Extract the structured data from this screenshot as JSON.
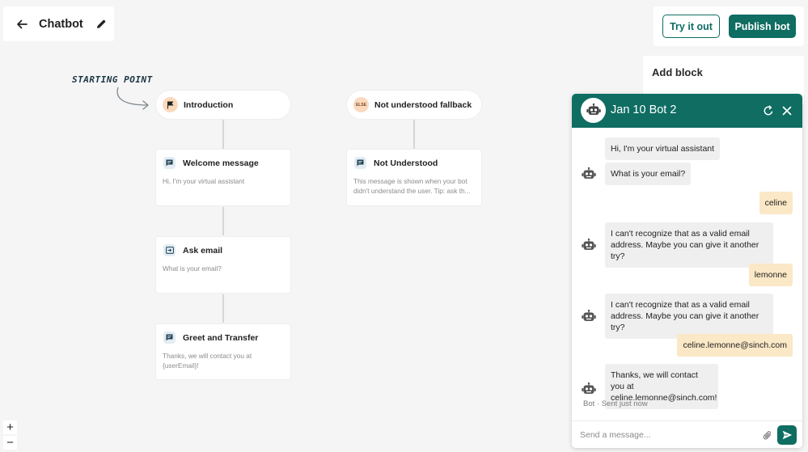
{
  "header": {
    "title": "Chatbot"
  },
  "actions": {
    "try_label": "Try it out",
    "publish_label": "Publish bot"
  },
  "sidebar": {
    "add_block_label": "Add block"
  },
  "canvas": {
    "starting_label": "STARTING POINT",
    "intro_label": "Introduction",
    "fallback_label": "Not understood fallback",
    "fallback_badge": "ELSE",
    "cards": [
      {
        "title": "Welcome message",
        "desc": "Hi, I'm your virtual assistant"
      },
      {
        "title": "Ask email",
        "desc": "What is your email?"
      },
      {
        "title": "Greet and Transfer",
        "desc": "Thanks, we will contact you at {userEmail}!"
      },
      {
        "title": "Not Understood",
        "desc": "This message is shown when your bot didn't understand the user. Tip: ask th..."
      }
    ],
    "zoom_in": "+",
    "zoom_out": "−"
  },
  "chat": {
    "bot_name": "Jan 10 Bot 2",
    "messages": [
      {
        "from": "bot",
        "text": "Hi, I'm your virtual assistant"
      },
      {
        "from": "bot",
        "text": "What is your email?"
      },
      {
        "from": "user",
        "text": "celine"
      },
      {
        "from": "bot",
        "text": "I can't recognize that as a valid email address. Maybe you can give it another try?"
      },
      {
        "from": "user",
        "text": "lemonne"
      },
      {
        "from": "bot",
        "text": "I can't recognize that as a valid email address. Maybe you can give it another try?"
      },
      {
        "from": "user",
        "text": "celine.lemonne@sinch.com"
      },
      {
        "from": "bot",
        "text": "Thanks, we will contact you at celine.lemonne@sinch.com!"
      }
    ],
    "status": "Bot · Sent just now",
    "input_placeholder": "Send a message..."
  },
  "colors": {
    "brand": "#0f6d62",
    "user_bubble": "#fbe8c6",
    "bot_bubble": "#efefef",
    "intro_badge": "#fbd9bd"
  },
  "icons": [
    "back-arrow-icon",
    "pencil-icon",
    "flag-icon",
    "message-icon",
    "input-icon",
    "robot-icon",
    "restart-icon",
    "close-icon",
    "paperclip-icon",
    "send-icon"
  ]
}
